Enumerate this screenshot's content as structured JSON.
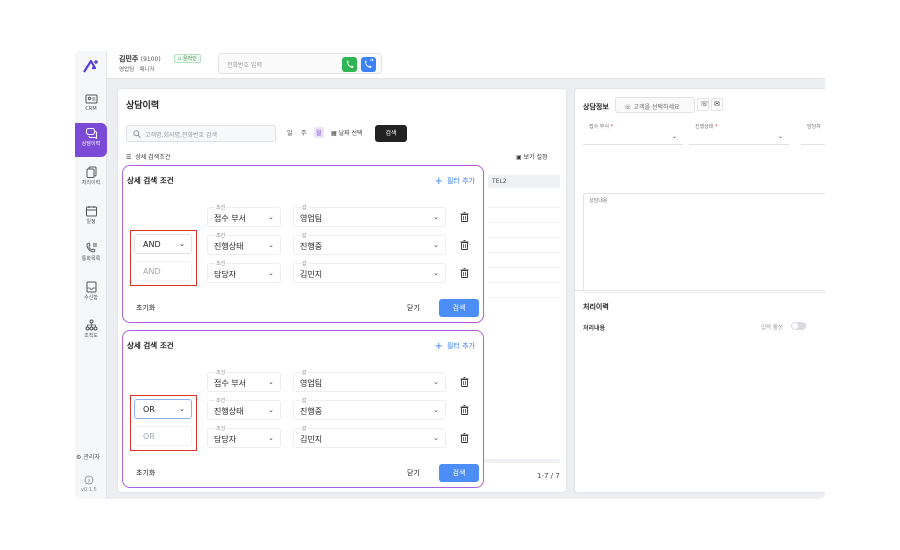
{
  "topbar": {
    "user_name": "김민주",
    "user_ext": "(9100)",
    "user_team": "영업팀",
    "user_role": "매니저",
    "status": "온라인",
    "phone_placeholder": "전화번호 입력"
  },
  "sidebar": {
    "items": [
      {
        "label": "CRM",
        "icon": "id-card-icon"
      },
      {
        "label": "상담이력",
        "icon": "chat-bubbles-icon"
      },
      {
        "label": "처리이력",
        "icon": "documents-icon"
      },
      {
        "label": "일정",
        "icon": "calendar-icon"
      },
      {
        "label": "통화목록",
        "icon": "phone-list-icon"
      },
      {
        "label": "수신함",
        "icon": "inbox-icon"
      },
      {
        "label": "조직도",
        "icon": "org-chart-icon"
      }
    ],
    "admin": "관리자",
    "version": "v0.1.5"
  },
  "history": {
    "title": "상담이력",
    "search_placeholder": "고객명,회사명,전화번호 검색",
    "periods": [
      "일",
      "주",
      "월"
    ],
    "date_select": "날짜 선택",
    "search_label": "검색",
    "adv_toggle": "상세 검색조건",
    "view_settings": "보기 설정",
    "table_col": "TEL2",
    "pager": "1-7 / 7"
  },
  "consult": {
    "title": "상담정보",
    "customer_placeholder": "고객을 선택하세요",
    "field_dept": "접수 부서",
    "field_status": "진행상태",
    "field_owner": "담당자",
    "memo_label": "상담내용",
    "process_title": "처리이력",
    "process_label": "처리내용",
    "input_toggle": "입력 활성"
  },
  "cards": [
    {
      "title": "상세 검색 조건",
      "add_filter": "필터 추가",
      "logic_selected": "AND",
      "logic_static": "AND",
      "rows": [
        {
          "cond_key": "조건",
          "cond": "접수 부서",
          "val_key": "값",
          "val": "영업팀"
        },
        {
          "cond_key": "조건",
          "cond": "진행상태",
          "val_key": "값",
          "val": "진행중"
        },
        {
          "cond_key": "조건",
          "cond": "담당자",
          "val_key": "값",
          "val": "김민지"
        }
      ],
      "reset": "초기화",
      "close": "닫기",
      "search": "검색"
    },
    {
      "title": "상세 검색 조건",
      "add_filter": "필터 추가",
      "logic_selected": "OR",
      "logic_static": "OR",
      "rows": [
        {
          "cond_key": "조건",
          "cond": "접수 부서",
          "val_key": "값",
          "val": "영업팀"
        },
        {
          "cond_key": "조건",
          "cond": "진행상태",
          "val_key": "값",
          "val": "진행중"
        },
        {
          "cond_key": "조건",
          "cond": "담당자",
          "val_key": "값",
          "val": "김민지"
        }
      ],
      "reset": "초기화",
      "close": "닫기",
      "search": "검색"
    }
  ],
  "colors": {
    "accent": "#7b4bd8",
    "card_border": "#a963e0",
    "highlight": "#d9342b",
    "primary_button": "#4c8df6"
  }
}
